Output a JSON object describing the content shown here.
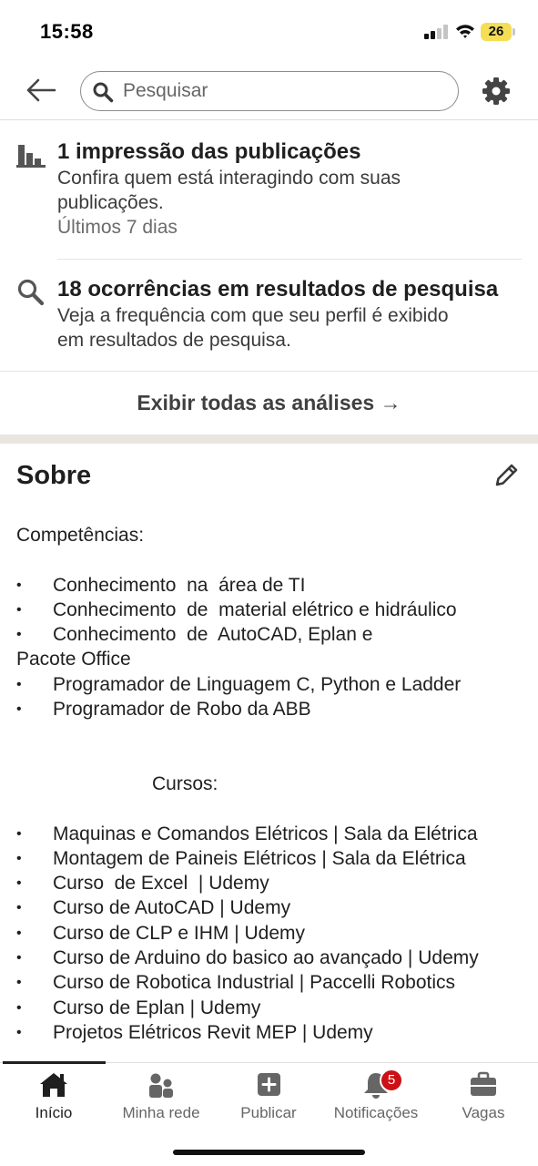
{
  "status_bar": {
    "time": "15:58",
    "battery": "26"
  },
  "header": {
    "search_placeholder": "Pesquisar",
    "icons": [
      "arrow-left-icon",
      "search-icon",
      "gear-icon"
    ]
  },
  "analytics": [
    {
      "icon": "bar-chart-icon",
      "title": "1 impressão das publicações",
      "desc_lines": [
        "Confira quem está interagindo com suas",
        "publicações."
      ],
      "meta": "Últimos 7 dias"
    },
    {
      "icon": "search-icon",
      "title": "18 ocorrências em resultados de pesquisa",
      "desc_lines": [
        "Veja a frequência com que seu perfil é exibido",
        "em resultados de pesquisa."
      ]
    }
  ],
  "view_all_label": "Exibir todas as análises →",
  "about": {
    "title": "Sobre",
    "competencias_heading": "Competências:",
    "competencias": [
      "Conhecimento  na  área de TI",
      "Conhecimento  de  material elétrico e hidráulico",
      "Conhecimento  de  AutoCAD, Eplan e"
    ],
    "competencias_continuation": "Pacote Office",
    "competencias_2": [
      "Programador de Linguagem C, Python e Ladder",
      "Programador de Robo da ABB"
    ],
    "cursos_heading": "Cursos:",
    "cursos": [
      "Maquinas e Comandos Elétricos | Sala da Elétrica",
      "Montagem de Paineis Elétricos | Sala da Elétrica",
      "Curso  de Excel  | Udemy",
      "Curso de AutoCAD | Udemy",
      "Curso de CLP e IHM | Udemy",
      "Curso de Arduino do basico ao avançado | Udemy",
      "Curso de Robotica Industrial | Paccelli Robotics",
      "Curso de Eplan | Udemy",
      "Projetos Elétricos Revit MEP | Udemy"
    ]
  },
  "bottom_nav": [
    {
      "label": "Início",
      "icon": "home-icon",
      "active": true
    },
    {
      "label": "Minha rede",
      "icon": "people-icon"
    },
    {
      "label": "Publicar",
      "icon": "plus-square-icon"
    },
    {
      "label": "Notificações",
      "icon": "bell-icon",
      "badge": "5"
    },
    {
      "label": "Vagas",
      "icon": "briefcase-icon"
    }
  ],
  "colors": {
    "accent_badge": "#cc1016",
    "battery": "#f4de55",
    "section_gap": "#e9e5df"
  }
}
